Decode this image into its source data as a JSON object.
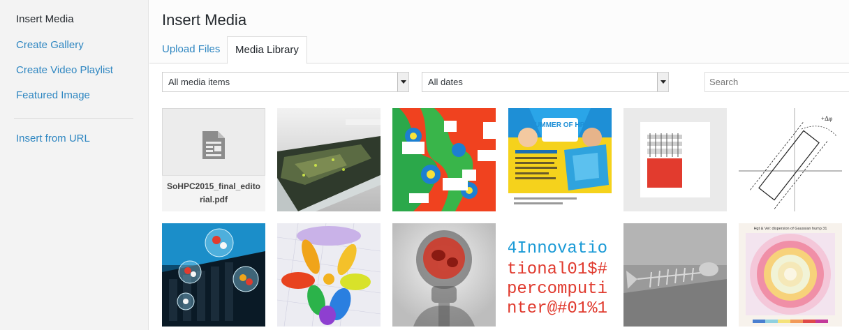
{
  "sidebar": {
    "items": [
      {
        "label": "Insert Media",
        "active": true
      },
      {
        "label": "Create Gallery",
        "active": false
      },
      {
        "label": "Create Video Playlist",
        "active": false
      },
      {
        "label": "Featured Image",
        "active": false
      }
    ],
    "secondary": [
      {
        "label": "Insert from URL"
      }
    ]
  },
  "header": {
    "title": "Insert Media",
    "tabs": [
      {
        "label": "Upload Files",
        "active": false
      },
      {
        "label": "Media Library",
        "active": true
      }
    ]
  },
  "toolbar": {
    "type_filter": "All media items",
    "date_filter": "All dates",
    "search_placeholder": "Search"
  },
  "attachments": [
    {
      "kind": "file",
      "filename": "SoHPC2015_final_editorial.pdf",
      "icon": "document-icon"
    },
    {
      "kind": "image",
      "subject": "terrain-render"
    },
    {
      "kind": "image",
      "subject": "fractal"
    },
    {
      "kind": "image",
      "subject": "summer-of-hpc-poster",
      "text": "SUMMER OF HPC"
    },
    {
      "kind": "image",
      "subject": "building-drawing"
    },
    {
      "kind": "image",
      "subject": "geometry-diagram",
      "text": "+Δφ"
    },
    {
      "kind": "image",
      "subject": "molecules-datacenter"
    },
    {
      "kind": "image",
      "subject": "orbital-lobes"
    },
    {
      "kind": "image",
      "subject": "xray-skull"
    },
    {
      "kind": "image",
      "subject": "typography",
      "lines": [
        "4Innovatio",
        "tional01$#",
        "percomputi",
        "nter@#01%1"
      ]
    },
    {
      "kind": "image",
      "subject": "fish-skeleton"
    },
    {
      "kind": "image",
      "subject": "dispersion-plot",
      "text": "Hgt & Vel: dispersion of Gaussian hump 31"
    }
  ],
  "colors": {
    "link": "#2e86c1",
    "sidebar_bg": "#f3f3f3",
    "header_bg": "#fcfcfc",
    "text": "#23282d"
  }
}
